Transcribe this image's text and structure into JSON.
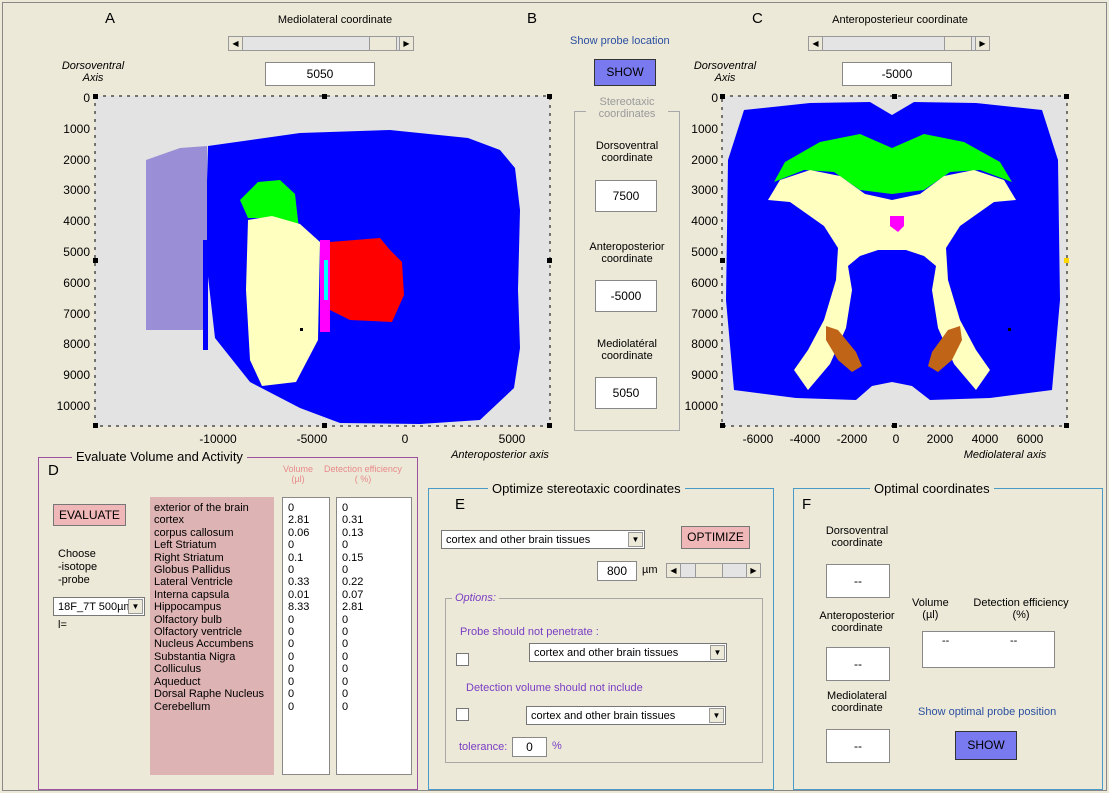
{
  "panels": {
    "a": {
      "letter": "A",
      "slider_title": "Mediolateral coordinate",
      "slider_value": "5050",
      "y_axis_label": "Dorsoventral\nAxis",
      "x_axis_label": "Anteroposterior axis",
      "y_ticks": [
        "0",
        "1000",
        "2000",
        "3000",
        "4000",
        "5000",
        "6000",
        "7000",
        "8000",
        "9000",
        "10000"
      ],
      "x_ticks": [
        "-10000",
        "-5000",
        "0",
        "5000"
      ]
    },
    "b": {
      "letter": "B",
      "show_probe_label": "Show probe location",
      "show_button": "SHOW",
      "group_title": "Stereotaxic\ncoordinates",
      "dv_label": "Dorsoventral\ncoordinate",
      "dv_value": "7500",
      "ap_label": "Anteroposterior\ncoordinate",
      "ap_value": "-5000",
      "ml_label": "Mediolatéral\ncoordinate",
      "ml_value": "5050"
    },
    "c": {
      "letter": "C",
      "slider_title": "Anteroposterieur coordinate",
      "slider_value": "-5000",
      "y_axis_label": "Dorsoventral\nAxis",
      "x_axis_label": "Mediolateral axis",
      "y_ticks": [
        "0",
        "1000",
        "2000",
        "3000",
        "4000",
        "5000",
        "6000",
        "7000",
        "8000",
        "9000",
        "10000"
      ],
      "x_ticks": [
        "-6000",
        "-4000",
        "-2000",
        "0",
        "2000",
        "4000",
        "6000"
      ]
    },
    "d": {
      "letter": "D",
      "title": "Evaluate Volume and Activity",
      "evaluate_button": "EVALUATE",
      "choose_label": "Choose\n-isotope\n-probe",
      "probe_select": "18F_7T  500µm l=",
      "volume_header": "Volume\n(µl)",
      "efficiency_header": "Detection efficiency\n( %)",
      "regions": [
        "exterior of the brain",
        "cortex",
        "corpus callosum",
        "Left Striatum",
        "Right Striatum",
        "Globus Pallidus",
        "Lateral Ventricle",
        "Interna capsula",
        "Hippocampus",
        "Olfactory bulb",
        "Olfactory ventricle",
        "Nucleus Accumbens",
        "Substantia Nigra",
        "Colliculus",
        "Aqueduct",
        "Dorsal Raphe Nucleus",
        "Cerebellum"
      ],
      "volumes": [
        "0",
        "2.81",
        "0.06",
        "0",
        "0.1",
        "0",
        "0.33",
        "0.01",
        "8.33",
        "0",
        "0",
        "0",
        "0",
        "0",
        "0",
        "0",
        "0"
      ],
      "efficiencies": [
        "0",
        "0.31",
        "0.13",
        "0",
        "0.15",
        "0",
        "0.22",
        "0.07",
        "2.81",
        "0",
        "0",
        "0",
        "0",
        "0",
        "0",
        "0",
        "0"
      ]
    },
    "e": {
      "letter": "E",
      "title": "Optimize stereotaxic coordinates",
      "target_select": "cortex and other brain tissues",
      "optimize_button": "OPTIMIZE",
      "size_value": "800",
      "size_unit": "µm",
      "options_title": "Options:",
      "no_penetrate_label": "Probe should not penetrate :",
      "no_penetrate_select": "cortex and other brain tissues",
      "no_include_label": "Detection volume should not include",
      "no_include_select": "cortex and other brain tissues",
      "tolerance_label": "tolerance:",
      "tolerance_value": "0",
      "tolerance_unit": "%"
    },
    "f": {
      "letter": "F",
      "title": "Optimal coordinates",
      "dv_label": "Dorsoventral\ncoordinate",
      "dv_value": "--",
      "ap_label": "Anteroposterior\ncoordinate",
      "ap_value": "--",
      "ml_label": "Mediolateral\ncoordinate",
      "ml_value": "--",
      "volume_header": "Volume\n(µl)",
      "efficiency_header": "Detection efficiency\n(%)",
      "volume_value": "--",
      "efficiency_value": "--",
      "show_optimal_label": "Show optimal probe position",
      "show_button": "SHOW"
    }
  },
  "colors": {
    "background": "#ECE9D8",
    "brain_blue": "#0000FF",
    "cortex_green": "#00FF00",
    "striatum_yellow": "#FFFFC0",
    "hippocampus_red": "#FF0000",
    "magenta": "#FF00FF",
    "cyan": "#00FFFF",
    "lavender": "#9A8FD6",
    "brown": "#C06418",
    "button_blue": "#7A7AF0",
    "button_pink": "#EFB7B7",
    "list_pink": "#DDB3B3",
    "header_pink": "#E88A8A",
    "border_purple": "#A050A0",
    "border_teal": "#4A9AC8"
  }
}
